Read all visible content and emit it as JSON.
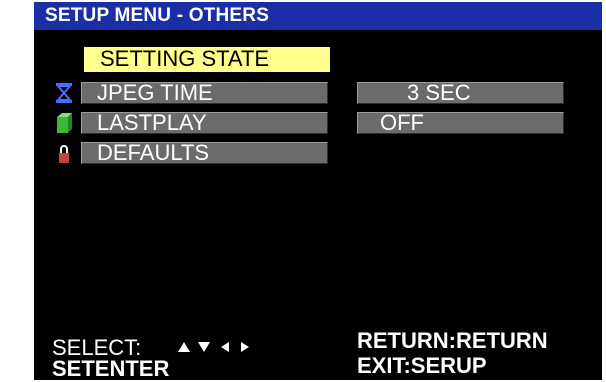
{
  "menu": {
    "title": "SETUP MENU - OTHERS",
    "header": "SETTING STATE",
    "items": [
      {
        "label": "JPEG TIME",
        "icon": "hourglass-icon",
        "value": "3 SEC"
      },
      {
        "label": "LASTPLAY",
        "icon": "green-box-icon",
        "value": "OFF"
      },
      {
        "label": "DEFAULTS",
        "icon": "lock-icon"
      }
    ]
  },
  "footer": {
    "select_label": "SELECT:",
    "arrows_icon": "arrow-keys-icon",
    "enter_label": "SETENTER",
    "return_label": "RETURN:RETURN",
    "exit_label": "EXIT:SERUP"
  },
  "colors": {
    "title_bar": "#1a2fa6",
    "highlight": "#ffff8c",
    "item_bar": "#6b6b6b",
    "background": "#000000",
    "hourglass": "#4a6bff",
    "box": "#3ab83a",
    "lock": "#c84040"
  }
}
